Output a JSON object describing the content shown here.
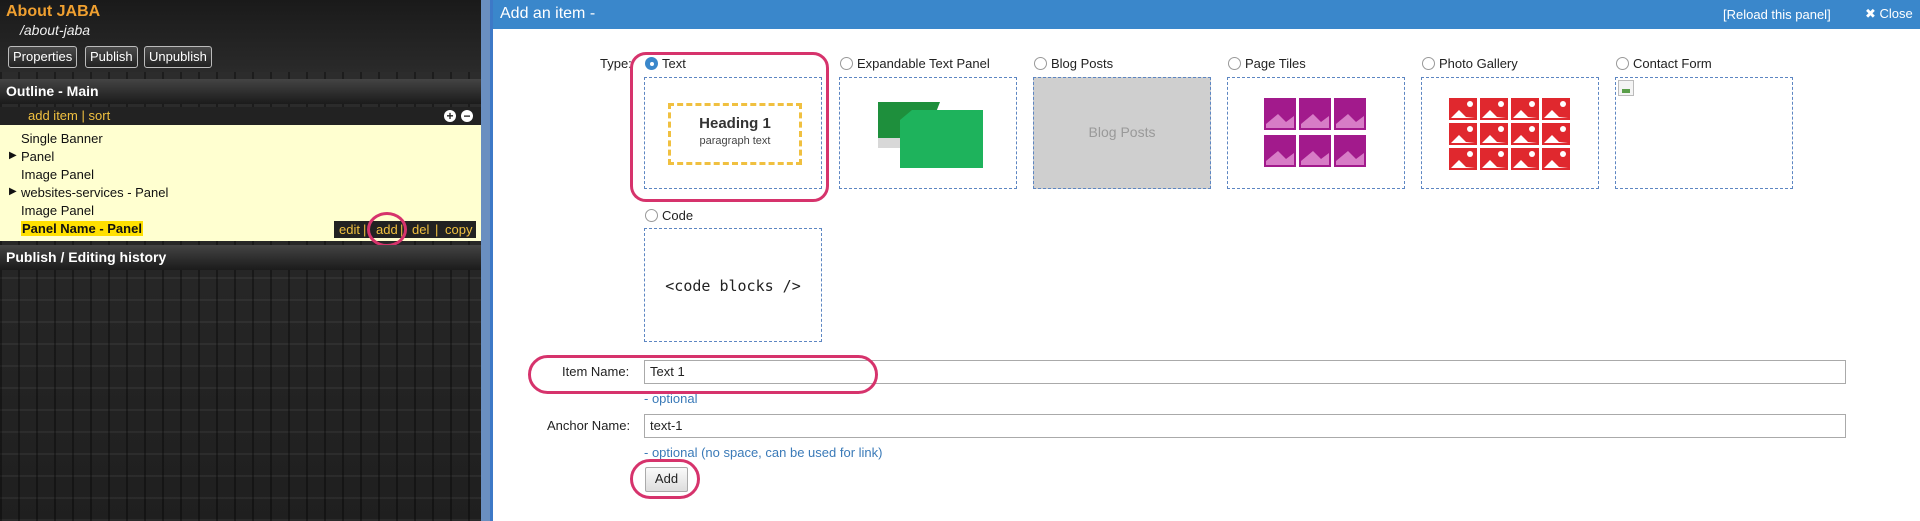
{
  "left": {
    "page_title": "About JABA",
    "page_path": "/about-jaba",
    "buttons": {
      "properties": "Properties",
      "publish": "Publish",
      "unpublish": "Unpublish"
    },
    "outline": {
      "title": "Outline - Main",
      "add_item": "add item",
      "separator": "|",
      "sort": "sort",
      "expand_icon": "plus",
      "collapse_icon": "minus",
      "items": [
        {
          "label": "Single Banner",
          "arrow": ""
        },
        {
          "label": "Panel",
          "arrow": "▶"
        },
        {
          "label": "Image Panel",
          "arrow": ""
        },
        {
          "label": "websites-services - Panel",
          "arrow": "▶"
        },
        {
          "label": "Image Panel",
          "arrow": ""
        },
        {
          "label": "Panel Name - Panel",
          "arrow": ""
        }
      ],
      "actions": {
        "edit": "edit",
        "add": "add",
        "del": "del",
        "copy": "copy"
      }
    },
    "history_title": "Publish / Editing history"
  },
  "right": {
    "title": "Add an item -",
    "reload": "[Reload this panel]",
    "close": "Close",
    "close_icon": "✖",
    "type_label": "Type:",
    "types": [
      {
        "label": "Text",
        "checked": true
      },
      {
        "label": "Expandable Text Panel",
        "checked": false
      },
      {
        "label": "Blog Posts",
        "checked": false
      },
      {
        "label": "Page Tiles",
        "checked": false
      },
      {
        "label": "Photo Gallery",
        "checked": false
      },
      {
        "label": "Contact Form",
        "checked": false
      },
      {
        "label": "Code",
        "checked": false
      }
    ],
    "previews": {
      "text_heading": "Heading 1",
      "text_paragraph": "paragraph text",
      "blog_posts": "Blog Posts",
      "code": "<code blocks />"
    },
    "item_name_label": "Item Name:",
    "item_name_value": "Text 1",
    "item_name_hint": "- optional",
    "anchor_name_label": "Anchor Name:",
    "anchor_name_value": "text-1",
    "anchor_name_hint": "- optional (no space, can be used for link)",
    "add_button": "Add"
  },
  "colors": {
    "accent_blue": "#3a87cb",
    "highlight_pink": "#d6336c",
    "title_orange": "#f0a030",
    "outline_bg": "#ffffd0"
  }
}
